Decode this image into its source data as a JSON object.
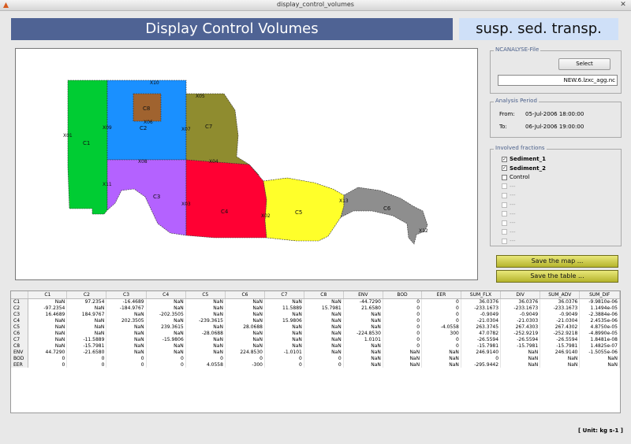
{
  "window": {
    "title": "display_control_volumes"
  },
  "header": {
    "title": "Display Control Volumes",
    "mode": "susp. sed. transp."
  },
  "map": {
    "regions": [
      {
        "id": "C1",
        "color": "#00cc33"
      },
      {
        "id": "C2",
        "color": "#1a90ff"
      },
      {
        "id": "C8",
        "color": "#a0632f"
      },
      {
        "id": "C7",
        "color": "#8f8c2f"
      },
      {
        "id": "C3",
        "color": "#b462ff"
      },
      {
        "id": "C4",
        "color": "#ff0033"
      },
      {
        "id": "C5",
        "color": "#ffff2a"
      },
      {
        "id": "C6",
        "color": "#8e8e8e"
      }
    ],
    "section_labels": [
      "X01",
      "X10",
      "X09",
      "X06",
      "X05",
      "X07",
      "X08",
      "X04",
      "X11",
      "X03",
      "X02",
      "X13",
      "X12"
    ]
  },
  "ncfile": {
    "group_title": "NCANALYSE-File",
    "select_label": "Select",
    "filename": "NEW.6.lzxc_agg.nc"
  },
  "period": {
    "group_title": "Analysis Period",
    "from_label": "From:",
    "from_value": "05-Jul-2006 18:00:00",
    "to_label": "To:",
    "to_value": "06-Jul-2006 19:00:00"
  },
  "fractions": {
    "group_title": "Involved fractions",
    "items": [
      {
        "label": "Sediment_1",
        "checked": true,
        "enabled": true
      },
      {
        "label": "Sediment_2",
        "checked": true,
        "enabled": true
      },
      {
        "label": "Control",
        "checked": false,
        "enabled": true
      },
      {
        "label": "---",
        "checked": false,
        "enabled": false
      },
      {
        "label": "---",
        "checked": false,
        "enabled": false
      },
      {
        "label": "---",
        "checked": false,
        "enabled": false
      },
      {
        "label": "---",
        "checked": false,
        "enabled": false
      },
      {
        "label": "---",
        "checked": false,
        "enabled": false
      },
      {
        "label": "---",
        "checked": false,
        "enabled": false
      },
      {
        "label": "---",
        "checked": false,
        "enabled": false
      }
    ]
  },
  "actions": {
    "save_map": "Save the map ...",
    "save_table": "Save the table ..."
  },
  "table": {
    "columns": [
      "C1",
      "C2",
      "C3",
      "C4",
      "C5",
      "C6",
      "C7",
      "C8",
      "ENV",
      "BOD",
      "EER",
      "SUM_FLX",
      "DIV",
      "SUM_ADV",
      "SUM_DIF"
    ],
    "rows": [
      {
        "name": "C1",
        "cells": [
          "NaN",
          "97.2354",
          "-16.4689",
          "NaN",
          "NaN",
          "NaN",
          "NaN",
          "NaN",
          "-44.7290",
          "0",
          "0",
          "36.0376",
          "36.0376",
          "36.0376",
          "-9.9810e-06"
        ]
      },
      {
        "name": "C2",
        "cells": [
          "-97.2354",
          "NaN",
          "-184.9767",
          "NaN",
          "NaN",
          "NaN",
          "11.5889",
          "15.7981",
          "21.6580",
          "0",
          "0",
          "-233.1673",
          "-233.1673",
          "-233.1673",
          "1.1494e-05"
        ]
      },
      {
        "name": "C3",
        "cells": [
          "16.4689",
          "184.9767",
          "NaN",
          "-202.3505",
          "NaN",
          "NaN",
          "NaN",
          "NaN",
          "NaN",
          "0",
          "0",
          "-0.9049",
          "-0.9049",
          "-0.9049",
          "-2.3884e-06"
        ]
      },
      {
        "name": "C4",
        "cells": [
          "NaN",
          "NaN",
          "202.3505",
          "NaN",
          "-239.3615",
          "NaN",
          "15.9806",
          "NaN",
          "NaN",
          "0",
          "0",
          "-21.0304",
          "-21.0303",
          "-21.0304",
          "2.4535e-06"
        ]
      },
      {
        "name": "C5",
        "cells": [
          "NaN",
          "NaN",
          "NaN",
          "239.3615",
          "NaN",
          "28.0688",
          "NaN",
          "NaN",
          "NaN",
          "0",
          "-4.0558",
          "263.3745",
          "267.4303",
          "267.4302",
          "4.8750e-05"
        ]
      },
      {
        "name": "C6",
        "cells": [
          "NaN",
          "NaN",
          "NaN",
          "NaN",
          "-28.0688",
          "NaN",
          "NaN",
          "NaN",
          "-224.8530",
          "0",
          "300",
          "47.0782",
          "-252.9219",
          "-252.9218",
          "-4.8990e-05"
        ]
      },
      {
        "name": "C7",
        "cells": [
          "NaN",
          "-11.5889",
          "NaN",
          "-15.9806",
          "NaN",
          "NaN",
          "NaN",
          "NaN",
          "1.0101",
          "0",
          "0",
          "-26.5594",
          "-26.5594",
          "-26.5594",
          "1.8481e-08"
        ]
      },
      {
        "name": "C8",
        "cells": [
          "NaN",
          "-15.7981",
          "NaN",
          "NaN",
          "NaN",
          "NaN",
          "NaN",
          "NaN",
          "NaN",
          "0",
          "0",
          "-15.7981",
          "-15.7981",
          "-15.7981",
          "1.4825e-07"
        ]
      },
      {
        "name": "ENV",
        "cells": [
          "44.7290",
          "-21.6580",
          "NaN",
          "NaN",
          "NaN",
          "224.8530",
          "-1.0101",
          "NaN",
          "NaN",
          "NaN",
          "NaN",
          "246.9140",
          "NaN",
          "246.9140",
          "-1.5055e-06"
        ]
      },
      {
        "name": "BOD",
        "cells": [
          "0",
          "0",
          "0",
          "0",
          "0",
          "0",
          "0",
          "0",
          "NaN",
          "NaN",
          "NaN",
          "0",
          "NaN",
          "NaN",
          "NaN"
        ]
      },
      {
        "name": "EER",
        "cells": [
          "0",
          "0",
          "0",
          "0",
          "4.0558",
          "-300",
          "0",
          "0",
          "NaN",
          "NaN",
          "NaN",
          "-295.9442",
          "NaN",
          "NaN",
          "NaN"
        ]
      }
    ]
  },
  "unit_label": "[ Unit:  kg s-1 ]"
}
